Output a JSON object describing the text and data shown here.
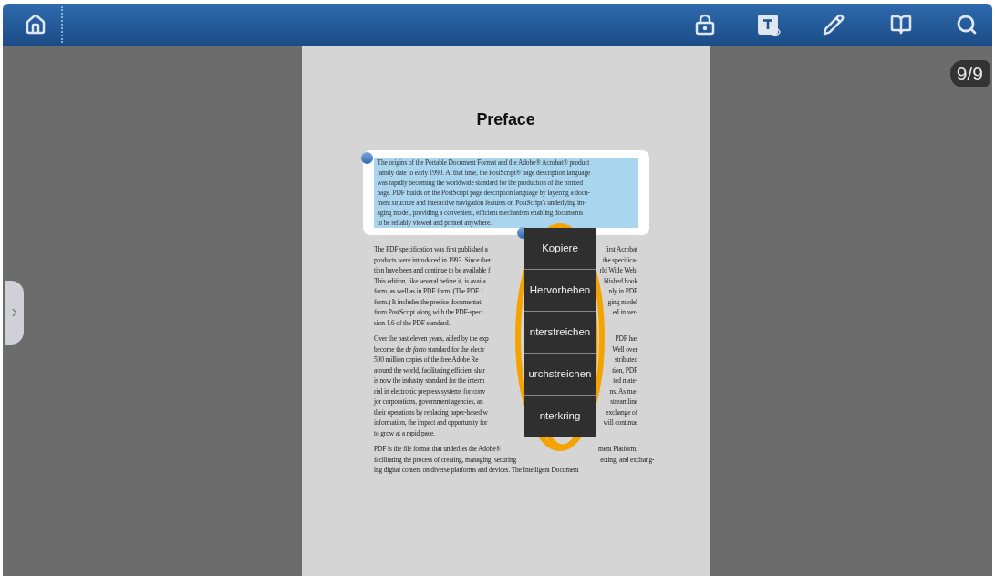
{
  "page_indicator": "9/9",
  "document": {
    "heading": "Preface",
    "selection": {
      "lines": [
        "The origins of the Portable Document Format and the Adobe® Acrobat® product",
        "family date to early 1990. At that time, the PostScript® page description language",
        "was rapidly becoming the worldwide standard for the production of the printed",
        "page. PDF builds on the PostScript page description language by layering a docu-",
        "ment structure and interactive navigation features on PostScript's underlying im-",
        "aging model, providing a convenient, efficient mechanism enabling documents",
        "to be reliably viewed and printed anywhere."
      ]
    },
    "paragraphs": [
      {
        "lines": [
          {
            "left": "The PDF specification was first published a",
            "right": "first Acrobat"
          },
          {
            "left": "products were introduced in 1993. Since ther",
            "right": "the specifica-"
          },
          {
            "left": "tion have been and continue to be available f",
            "right": "rld Wide Web."
          },
          {
            "left": "This edition, like several before it, is availa",
            "right": "blished book"
          },
          {
            "left": "form, as well as in PDF form. (The PDF 1",
            "right": "nly in PDF"
          },
          {
            "left": "form.) It includes the precise documentati",
            "right": "ging model"
          },
          {
            "left": "from PostScript along with the PDF-speci",
            "right": "ed in ver-"
          },
          {
            "left": "sion 1.6 of the PDF standard."
          }
        ]
      },
      {
        "lines": [
          {
            "left": "Over the past eleven years, aided by the exp",
            "right": "PDF has"
          },
          {
            "left": "become the *de facto* standard for the electr",
            "right": "Well over"
          },
          {
            "left": "500 million copies of the free Adobe Re",
            "right": "stributed"
          },
          {
            "left": "around the world, facilitating efficient shar",
            "right": "tion, PDF"
          },
          {
            "left": "is now the industry standard for the interm",
            "right": "ted mate-"
          },
          {
            "left": "rial in electronic prepress systems for conv",
            "right": "ns. As ma-"
          },
          {
            "left": "jor corporations, government agencies, an",
            "right": "streamline"
          },
          {
            "left": "their operations by replacing paper-based w",
            "right": "exchange of"
          },
          {
            "left": "information, the impact and opportunity for",
            "right": "will continue"
          },
          {
            "left": "to grow at a rapid pace."
          }
        ]
      },
      {
        "lines": [
          {
            "left": "PDF is the file format that underlies the Adobe®",
            "right": "ment Platform,"
          },
          {
            "left": "facilitating the process of creating, managing, securing",
            "right": "ecting, and exchang-"
          },
          {
            "left": "ing digital content on diverse platforms and devices. The Intelligent Document"
          }
        ]
      }
    ]
  },
  "context_menu": {
    "items": [
      {
        "label": "Kopiere"
      },
      {
        "label": "Hervorheben"
      },
      {
        "label": "nterstreichen"
      },
      {
        "label": "urchstreichen"
      },
      {
        "label": "nterkring"
      }
    ]
  }
}
